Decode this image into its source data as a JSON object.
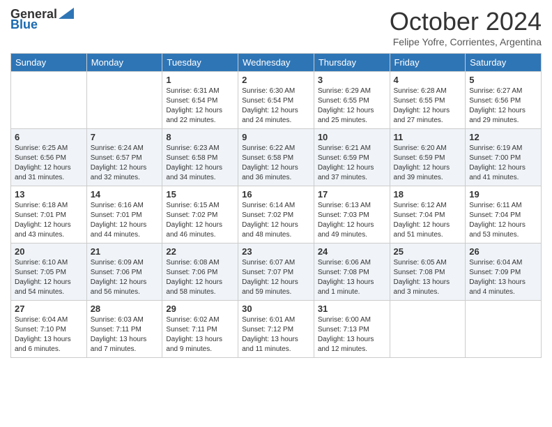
{
  "header": {
    "logo_general": "General",
    "logo_blue": "Blue",
    "month_title": "October 2024",
    "subtitle": "Felipe Yofre, Corrientes, Argentina"
  },
  "days_of_week": [
    "Sunday",
    "Monday",
    "Tuesday",
    "Wednesday",
    "Thursday",
    "Friday",
    "Saturday"
  ],
  "weeks": [
    [
      {
        "day": "",
        "content": ""
      },
      {
        "day": "",
        "content": ""
      },
      {
        "day": "1",
        "content": "Sunrise: 6:31 AM\nSunset: 6:54 PM\nDaylight: 12 hours and 22 minutes."
      },
      {
        "day": "2",
        "content": "Sunrise: 6:30 AM\nSunset: 6:54 PM\nDaylight: 12 hours and 24 minutes."
      },
      {
        "day": "3",
        "content": "Sunrise: 6:29 AM\nSunset: 6:55 PM\nDaylight: 12 hours and 25 minutes."
      },
      {
        "day": "4",
        "content": "Sunrise: 6:28 AM\nSunset: 6:55 PM\nDaylight: 12 hours and 27 minutes."
      },
      {
        "day": "5",
        "content": "Sunrise: 6:27 AM\nSunset: 6:56 PM\nDaylight: 12 hours and 29 minutes."
      }
    ],
    [
      {
        "day": "6",
        "content": "Sunrise: 6:25 AM\nSunset: 6:56 PM\nDaylight: 12 hours and 31 minutes."
      },
      {
        "day": "7",
        "content": "Sunrise: 6:24 AM\nSunset: 6:57 PM\nDaylight: 12 hours and 32 minutes."
      },
      {
        "day": "8",
        "content": "Sunrise: 6:23 AM\nSunset: 6:58 PM\nDaylight: 12 hours and 34 minutes."
      },
      {
        "day": "9",
        "content": "Sunrise: 6:22 AM\nSunset: 6:58 PM\nDaylight: 12 hours and 36 minutes."
      },
      {
        "day": "10",
        "content": "Sunrise: 6:21 AM\nSunset: 6:59 PM\nDaylight: 12 hours and 37 minutes."
      },
      {
        "day": "11",
        "content": "Sunrise: 6:20 AM\nSunset: 6:59 PM\nDaylight: 12 hours and 39 minutes."
      },
      {
        "day": "12",
        "content": "Sunrise: 6:19 AM\nSunset: 7:00 PM\nDaylight: 12 hours and 41 minutes."
      }
    ],
    [
      {
        "day": "13",
        "content": "Sunrise: 6:18 AM\nSunset: 7:01 PM\nDaylight: 12 hours and 43 minutes."
      },
      {
        "day": "14",
        "content": "Sunrise: 6:16 AM\nSunset: 7:01 PM\nDaylight: 12 hours and 44 minutes."
      },
      {
        "day": "15",
        "content": "Sunrise: 6:15 AM\nSunset: 7:02 PM\nDaylight: 12 hours and 46 minutes."
      },
      {
        "day": "16",
        "content": "Sunrise: 6:14 AM\nSunset: 7:02 PM\nDaylight: 12 hours and 48 minutes."
      },
      {
        "day": "17",
        "content": "Sunrise: 6:13 AM\nSunset: 7:03 PM\nDaylight: 12 hours and 49 minutes."
      },
      {
        "day": "18",
        "content": "Sunrise: 6:12 AM\nSunset: 7:04 PM\nDaylight: 12 hours and 51 minutes."
      },
      {
        "day": "19",
        "content": "Sunrise: 6:11 AM\nSunset: 7:04 PM\nDaylight: 12 hours and 53 minutes."
      }
    ],
    [
      {
        "day": "20",
        "content": "Sunrise: 6:10 AM\nSunset: 7:05 PM\nDaylight: 12 hours and 54 minutes."
      },
      {
        "day": "21",
        "content": "Sunrise: 6:09 AM\nSunset: 7:06 PM\nDaylight: 12 hours and 56 minutes."
      },
      {
        "day": "22",
        "content": "Sunrise: 6:08 AM\nSunset: 7:06 PM\nDaylight: 12 hours and 58 minutes."
      },
      {
        "day": "23",
        "content": "Sunrise: 6:07 AM\nSunset: 7:07 PM\nDaylight: 12 hours and 59 minutes."
      },
      {
        "day": "24",
        "content": "Sunrise: 6:06 AM\nSunset: 7:08 PM\nDaylight: 13 hours and 1 minute."
      },
      {
        "day": "25",
        "content": "Sunrise: 6:05 AM\nSunset: 7:08 PM\nDaylight: 13 hours and 3 minutes."
      },
      {
        "day": "26",
        "content": "Sunrise: 6:04 AM\nSunset: 7:09 PM\nDaylight: 13 hours and 4 minutes."
      }
    ],
    [
      {
        "day": "27",
        "content": "Sunrise: 6:04 AM\nSunset: 7:10 PM\nDaylight: 13 hours and 6 minutes."
      },
      {
        "day": "28",
        "content": "Sunrise: 6:03 AM\nSunset: 7:11 PM\nDaylight: 13 hours and 7 minutes."
      },
      {
        "day": "29",
        "content": "Sunrise: 6:02 AM\nSunset: 7:11 PM\nDaylight: 13 hours and 9 minutes."
      },
      {
        "day": "30",
        "content": "Sunrise: 6:01 AM\nSunset: 7:12 PM\nDaylight: 13 hours and 11 minutes."
      },
      {
        "day": "31",
        "content": "Sunrise: 6:00 AM\nSunset: 7:13 PM\nDaylight: 13 hours and 12 minutes."
      },
      {
        "day": "",
        "content": ""
      },
      {
        "day": "",
        "content": ""
      }
    ]
  ]
}
